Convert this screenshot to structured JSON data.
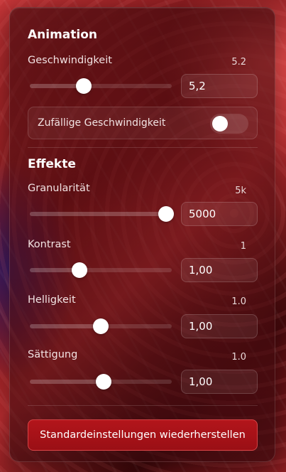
{
  "animation": {
    "title": "Animation",
    "speed": {
      "label": "Geschwindigkeit",
      "readout": "5.2",
      "input_value": "5,2",
      "slider_fraction": 0.38
    },
    "random_speed": {
      "label": "Zufällige Geschwindigkeit",
      "enabled": false
    }
  },
  "effects": {
    "title": "Effekte",
    "granularity": {
      "label": "Granularität",
      "readout": "5k",
      "input_value": "5000",
      "slider_fraction": 0.96
    },
    "contrast": {
      "label": "Kontrast",
      "readout": "1",
      "input_value": "1,00",
      "slider_fraction": 0.35
    },
    "brightness": {
      "label": "Helligkeit",
      "readout": "1.0",
      "input_value": "1,00",
      "slider_fraction": 0.5
    },
    "saturation": {
      "label": "Sättigung",
      "readout": "1.0",
      "input_value": "1,00",
      "slider_fraction": 0.52
    }
  },
  "reset_button": {
    "label": "Standardeinstellungen wiederherstellen"
  },
  "colors": {
    "accent_button": "#a8121a",
    "thumb": "#ffffff"
  }
}
